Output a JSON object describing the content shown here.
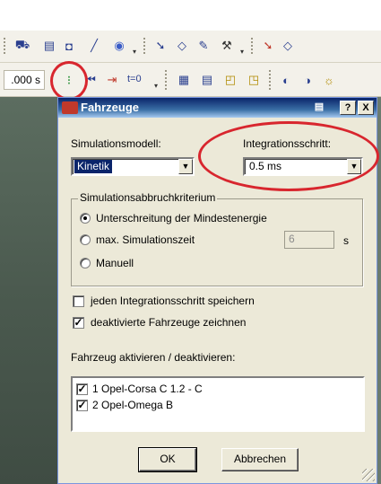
{
  "toolbar": {
    "time_value": ".000 s",
    "t0_label": "t=0",
    "icons_row1": [
      "car-icon",
      "tree-icon",
      "camera-icon",
      "line-tool-icon",
      "help-icon",
      "pointer-icon",
      "polygon-icon",
      "marker-icon",
      "crane-icon",
      "arrow-select-icon",
      "shape-icon"
    ],
    "icons_row2": [
      "traffic-light-icon",
      "skip-icon",
      "step-icon",
      "reset-time-icon",
      "bmp-export-icon",
      "scale-icon",
      "copy-icon",
      "paste-icon",
      "sun-icon"
    ]
  },
  "dialog": {
    "title": "Fahrzeuge",
    "help_btn": "?",
    "close_btn": "X",
    "sim_model": {
      "label": "Simulationsmodell:",
      "value": "Kinetik"
    },
    "integration": {
      "label": "Integrationsschritt:",
      "value": "0.5 ms"
    },
    "abort_group": {
      "title": "Simulationsabbruchkriterium",
      "options": [
        {
          "label": "Unterschreitung der Mindestenergie",
          "selected": true
        },
        {
          "label": "max. Simulationszeit",
          "selected": false
        },
        {
          "label": "Manuell",
          "selected": false
        }
      ],
      "max_time_value": "6",
      "max_time_unit": "s"
    },
    "checkboxes": [
      {
        "label": "jeden Integrationsschritt speichern",
        "checked": false
      },
      {
        "label": "deaktivierte Fahrzeuge zeichnen",
        "checked": true
      }
    ],
    "vehicle_list": {
      "label": "Fahrzeug aktivieren / deaktivieren:",
      "items": [
        {
          "label": "1  Opel-Corsa C 1.2  - C",
          "checked": true
        },
        {
          "label": "2  Opel-Omega B",
          "checked": true
        }
      ]
    },
    "ok_label": "OK",
    "cancel_label": "Abbrechen"
  },
  "colors": {
    "highlight": "#d8262e",
    "titlebar": "#0a246a",
    "dialog_bg": "#ece9d8"
  }
}
